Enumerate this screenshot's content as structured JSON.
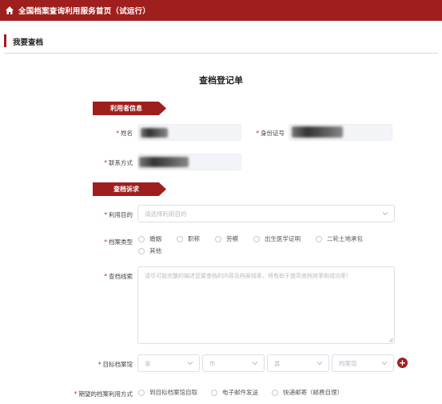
{
  "header": {
    "title": "全国档案查询利用服务首页（试运行）",
    "home_icon": "home-icon"
  },
  "section": {
    "title": "我要查档"
  },
  "form": {
    "title": "查档登记单",
    "user_info": {
      "ribbon": "利用者信息",
      "name_label": "姓名",
      "id_label": "身份证号",
      "contact_label": "联系方式"
    },
    "request": {
      "ribbon": "查档诉求",
      "purpose_label": "利用目的",
      "purpose_placeholder": "请选择利用目的",
      "type_label": "档案类型",
      "types": [
        "婚姻",
        "职称",
        "劳模",
        "出生医学证明",
        "二轮土地承包",
        "其他"
      ],
      "clue_label": "查档线索",
      "clue_placeholder": "请尽可能完整的描述您要查档的内容及档案线索，将有助于提高查档效率和成功率！",
      "archive_label": "目标档案馆",
      "province_placeholder": "省",
      "city_placeholder": "市",
      "county_placeholder": "县",
      "archive_placeholder": "档案馆",
      "method_label": "期望的档案利用方式",
      "methods": [
        "到目标档案馆自取",
        "电子邮件发送",
        "快递邮寄（邮费自理）"
      ]
    }
  },
  "colors": {
    "brand": "#9f1f1e",
    "required": "#c0282a"
  }
}
